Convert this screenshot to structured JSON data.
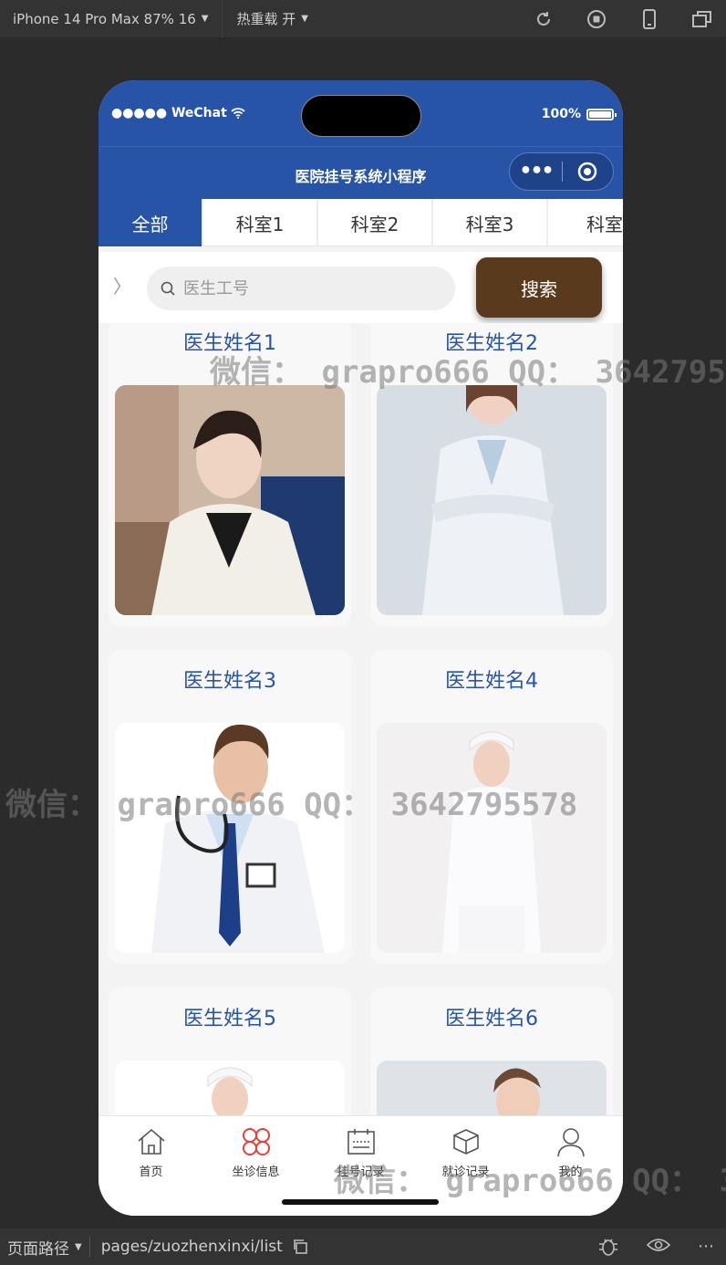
{
  "devtools": {
    "device": "iPhone 14 Pro Max 87% 16",
    "hot_reload": "热重载 开",
    "path_label": "页面路径",
    "path": "pages/zuozhenxinxi/list"
  },
  "status": {
    "carrier": "●●●●● WeChat",
    "battery": "100%"
  },
  "nav": {
    "title": "医院挂号系统小程序"
  },
  "tabs": [
    "全部",
    "科室1",
    "科室2",
    "科室3",
    "科室"
  ],
  "search": {
    "placeholder": "医生工号",
    "button": "搜索"
  },
  "doctors": [
    {
      "name": "医生姓名1"
    },
    {
      "name": "医生姓名2"
    },
    {
      "name": "医生姓名3"
    },
    {
      "name": "医生姓名4"
    },
    {
      "name": "医生姓名5"
    },
    {
      "name": "医生姓名6"
    }
  ],
  "bottom_nav": [
    {
      "label": "首页",
      "icon": "home-icon"
    },
    {
      "label": "坐诊信息",
      "icon": "clover-icon"
    },
    {
      "label": "挂号记录",
      "icon": "calendar-icon"
    },
    {
      "label": "就诊记录",
      "icon": "box-icon"
    },
    {
      "label": "我的",
      "icon": "user-icon"
    }
  ],
  "watermark": "微信： grapro666 QQ： 3642795578",
  "colors": {
    "primary": "#2854a8",
    "search_button": "#5a3a1c",
    "active_nav_icon": "#e2403a"
  }
}
